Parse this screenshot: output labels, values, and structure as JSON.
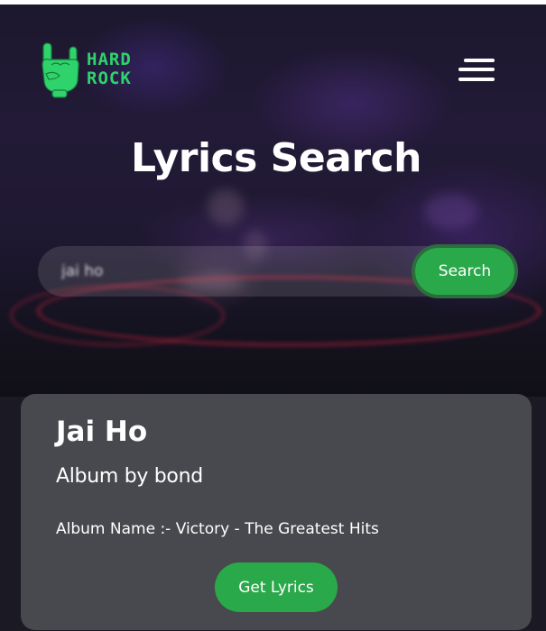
{
  "header": {
    "logo": {
      "line1": "HARD",
      "line2": "ROCK",
      "icon": "rock-hand-icon",
      "color": "#2fd36c"
    },
    "menu_icon": "hamburger-menu-icon"
  },
  "hero": {
    "title": "Lyrics Search"
  },
  "search": {
    "value": "jai ho",
    "button_label": "Search",
    "button_color": "#2aa94a"
  },
  "result": {
    "song_title": "Jai Ho",
    "artist_line": "Album by bond",
    "album_line": "Album Name :- Victory - The Greatest Hits",
    "button_label": "Get Lyrics",
    "card_color": "#48494e"
  }
}
